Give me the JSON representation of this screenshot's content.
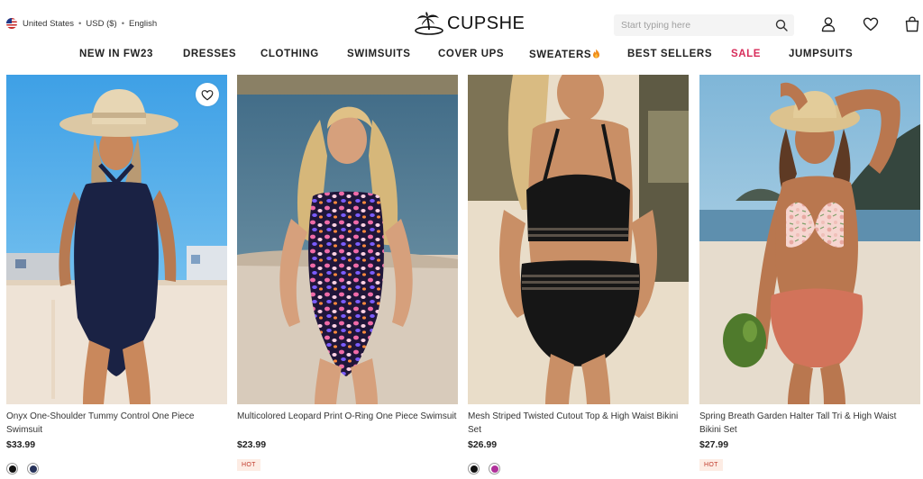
{
  "locale": {
    "country": "United States",
    "currency": "USD ($)",
    "language": "English",
    "bullet": "•"
  },
  "brand": {
    "name": "CUPSHE"
  },
  "search": {
    "placeholder": "Start typing here"
  },
  "nav": {
    "items": [
      {
        "label": "NEW IN FW23"
      },
      {
        "label": "DRESSES"
      },
      {
        "label": "CLOTHING"
      },
      {
        "label": "SWIMSUITS"
      },
      {
        "label": "COVER UPS"
      },
      {
        "label": "SWEATERS"
      },
      {
        "label": "BEST SELLERS"
      },
      {
        "label": "SALE"
      },
      {
        "label": "JUMPSUITS"
      }
    ]
  },
  "products": [
    {
      "title": "Onyx One-Shoulder Tummy Control One Piece Swimsuit",
      "price": "$33.99",
      "swatches": [
        "#111111",
        "#27325a"
      ]
    },
    {
      "title": "Multicolored Leopard Print O-Ring One Piece Swimsuit",
      "price": "$23.99",
      "badge": "HOT"
    },
    {
      "title": "Mesh Striped Twisted Cutout Top & High Waist Bikini Set",
      "price": "$26.99",
      "swatches": [
        "#111111",
        "#b0309a"
      ]
    },
    {
      "title": "Spring Breath Garden Halter Tall Tri & High Waist Bikini Set",
      "price": "$27.99",
      "badge": "HOT"
    }
  ],
  "icons": {
    "search": "search-icon",
    "account": "user-icon",
    "wishlist": "heart-icon",
    "cart": "shopping-bag-icon",
    "sweaters_marker": "flame-icon"
  },
  "colors": {
    "sale": "#d72c5a",
    "badge_text": "#c0392b",
    "badge_bg": "#fdece4"
  }
}
